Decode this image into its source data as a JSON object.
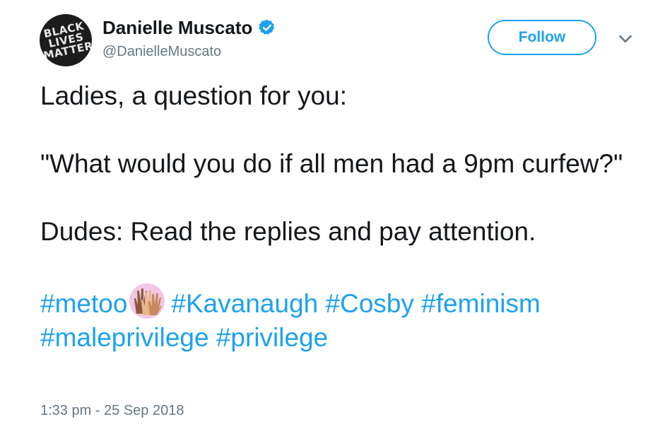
{
  "user": {
    "display_name": "Danielle Muscato",
    "handle": "@DanielleMuscato",
    "avatar_text": "BLACK\nLIVES\nMATTER",
    "verified": true
  },
  "actions": {
    "follow_label": "Follow"
  },
  "tweet": {
    "line1": "Ladies, a question for you:",
    "line2": "\"What would you do if all men had a 9pm curfew?\"",
    "line3": "Dudes: Read the replies and pay attention.",
    "hashtags": [
      "#metoo",
      "#Kavanaugh",
      "#Cosby",
      "#feminism",
      "#maleprivilege",
      "#privilege"
    ],
    "emoji": "raised-hands-diverse-emoji",
    "timestamp": "1:33 pm - 25 Sep 2018"
  },
  "colors": {
    "accent": "#1da1f2",
    "text": "#14171a",
    "muted": "#657786",
    "emoji_bg": "#f3c6e6"
  }
}
